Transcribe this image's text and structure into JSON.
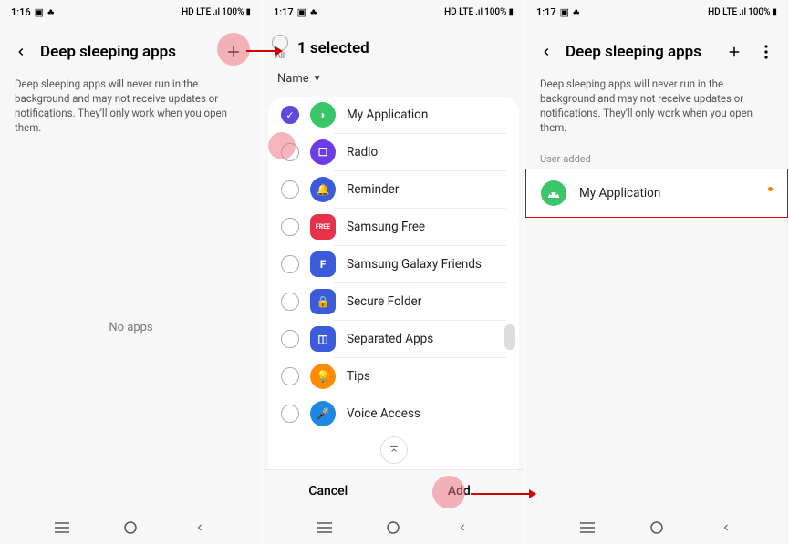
{
  "status": {
    "time1": "1:16",
    "time2": "1:17",
    "time3": "1:17",
    "net": "HD LTE",
    "signal": ".ıl",
    "battery": "100%"
  },
  "screen1": {
    "title": "Deep sleeping apps",
    "desc": "Deep sleeping apps will never run in the background and may not receive updates or notifications. They'll only work when you open them.",
    "empty": "No apps"
  },
  "screen2": {
    "all_label": "All",
    "selected_title": "1 selected",
    "sort_label": "Name",
    "apps": [
      {
        "name": "My Application",
        "checked": true,
        "color": "#3ac569",
        "glyph": "◗"
      },
      {
        "name": "Radio",
        "checked": false,
        "color": "#6a3de8",
        "glyph": "☐"
      },
      {
        "name": "Reminder",
        "checked": false,
        "color": "#3b5bdb",
        "glyph": "🔔"
      },
      {
        "name": "Samsung Free",
        "checked": false,
        "color": "#e6324b",
        "glyph": "FREE"
      },
      {
        "name": "Samsung Galaxy Friends",
        "checked": false,
        "color": "#3b5bdb",
        "glyph": "F"
      },
      {
        "name": "Secure Folder",
        "checked": false,
        "color": "#3b5bdb",
        "glyph": "🔒"
      },
      {
        "name": "Separated Apps",
        "checked": false,
        "color": "#3b5bdb",
        "glyph": "◫"
      },
      {
        "name": "Tips",
        "checked": false,
        "color": "#ff8c00",
        "glyph": "💡"
      },
      {
        "name": "Voice Access",
        "checked": false,
        "color": "#1e88e5",
        "glyph": "🎤"
      }
    ],
    "cancel": "Cancel",
    "add": "Add"
  },
  "screen3": {
    "title": "Deep sleeping apps",
    "desc": "Deep sleeping apps will never run in the background and may not receive updates or notifications. They'll only work when you open them.",
    "section": "User-added",
    "app": {
      "name": "My Application",
      "color": "#3ac569"
    }
  }
}
